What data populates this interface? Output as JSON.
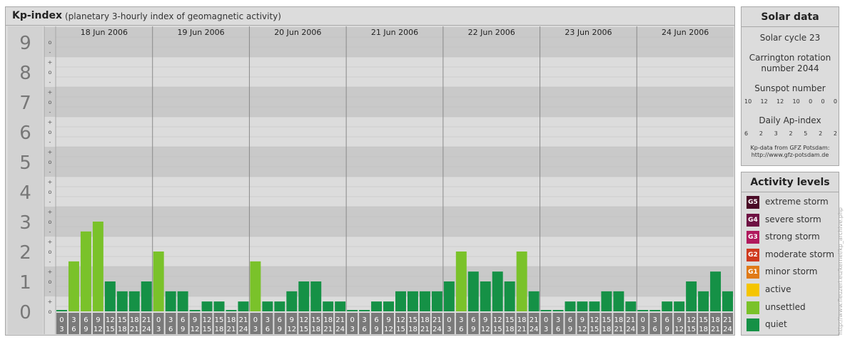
{
  "header": {
    "title": "Kp-index",
    "subtitle": "(planetary 3-hourly index of geomagnetic activity)"
  },
  "chart_data": {
    "type": "bar",
    "y_levels": [
      "0",
      "1",
      "2",
      "3",
      "4",
      "5",
      "6",
      "7",
      "8",
      "9"
    ],
    "minor_ticks": [
      "-",
      "o",
      "+"
    ],
    "ylim": [
      0,
      9.5
    ],
    "days": [
      "18 Jun 2006",
      "19 Jun 2006",
      "20 Jun 2006",
      "21 Jun 2006",
      "22 Jun 2006",
      "23 Jun 2006",
      "24 Jun 2006"
    ],
    "interval_top": [
      "0",
      "3",
      "6",
      "9",
      "12",
      "15",
      "18",
      "21"
    ],
    "interval_bottom": [
      "3",
      "6",
      "9",
      "12",
      "15",
      "18",
      "21",
      "24"
    ],
    "values": [
      [
        0.0,
        1.67,
        2.67,
        3.0,
        1.0,
        0.67,
        0.67,
        1.0
      ],
      [
        2.0,
        0.67,
        0.67,
        0.0,
        0.33,
        0.33,
        0.0,
        0.33
      ],
      [
        1.67,
        0.33,
        0.33,
        0.67,
        1.0,
        1.0,
        0.33,
        0.33
      ],
      [
        0.0,
        0.0,
        0.33,
        0.33,
        0.67,
        0.67,
        0.67,
        0.67
      ],
      [
        1.0,
        2.0,
        1.33,
        1.0,
        1.33,
        1.0,
        2.0,
        0.67
      ],
      [
        0.0,
        0.0,
        0.33,
        0.33,
        0.33,
        0.67,
        0.67,
        0.33
      ],
      [
        0.0,
        0.0,
        0.33,
        0.33,
        1.0,
        0.67,
        1.33,
        0.67
      ]
    ],
    "colors": {
      "quiet": "#159146",
      "unsettled": "#7ac22a",
      "active": "#f5c500",
      "band_dark": "#c9c9c9",
      "band_light": "#dcdcdc"
    },
    "grid": true
  },
  "solar": {
    "title": "Solar data",
    "cycle": "Solar cycle 23",
    "carrington_line1": "Carrington rotation",
    "carrington_line2": "number 2044",
    "sunspot_title": "Sunspot number",
    "sunspot_values": [
      "10",
      "12",
      "12",
      "10",
      "0",
      "0",
      "0"
    ],
    "ap_title": "Daily Ap-index",
    "ap_values": [
      "6",
      "2",
      "3",
      "2",
      "5",
      "2",
      "2"
    ],
    "credit_line1": "Kp-data from GFZ Potsdam:",
    "credit_line2": "http://www.gfz-potsdam.de"
  },
  "activity": {
    "title": "Activity levels",
    "levels": [
      {
        "badge": "G5",
        "label": "extreme storm",
        "color": "#4a0a26"
      },
      {
        "badge": "G4",
        "label": "severe storm",
        "color": "#6e1143"
      },
      {
        "badge": "G3",
        "label": "strong storm",
        "color": "#b0195d"
      },
      {
        "badge": "G2",
        "label": "moderate storm",
        "color": "#cf3a1f"
      },
      {
        "badge": "G1",
        "label": "minor storm",
        "color": "#e07a17"
      },
      {
        "badge": "",
        "label": "active",
        "color": "#f5c500"
      },
      {
        "badge": "",
        "label": "unsettled",
        "color": "#7ac22a"
      },
      {
        "badge": "",
        "label": "quiet",
        "color": "#159146"
      }
    ]
  },
  "watermark": "http://www.fleuzeri.eu/kernel/kp_archive.php"
}
